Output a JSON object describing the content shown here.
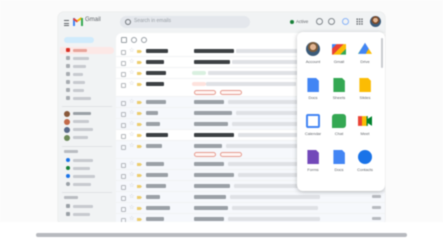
{
  "header": {
    "app_name": "Gmail",
    "search_placeholder": "Search in emails",
    "status": "Active",
    "icons": [
      "menu-icon",
      "gmail-logo",
      "search-icon",
      "status-dot",
      "help-icon",
      "settings-icon",
      "gemini-icon",
      "apps-grid-icon",
      "avatar"
    ]
  },
  "apps_panel": {
    "items": [
      {
        "label": "Account",
        "icon": "account-icon",
        "color": "#7a5a3a"
      },
      {
        "label": "Gmail",
        "icon": "gmail-icon",
        "color": "#ea4335"
      },
      {
        "label": "Drive",
        "icon": "drive-icon",
        "color": "#fbbc04"
      },
      {
        "label": "Docs",
        "icon": "docs-icon",
        "color": "#4285f4"
      },
      {
        "label": "Sheets",
        "icon": "sheets-icon",
        "color": "#34a853"
      },
      {
        "label": "Slides",
        "icon": "slides-icon",
        "color": "#fbbc04"
      },
      {
        "label": "Calendar",
        "icon": "calendar-icon",
        "color": "#4285f4"
      },
      {
        "label": "Chat",
        "icon": "chat-icon",
        "color": "#34a853"
      },
      {
        "label": "Meet",
        "icon": "meet-icon",
        "color": "#00832d"
      },
      {
        "label": "Forms",
        "icon": "forms-icon",
        "color": "#7248b9"
      },
      {
        "label": "Docs",
        "icon": "docs-icon",
        "color": "#4285f4"
      },
      {
        "label": "Contacts",
        "icon": "contacts-icon",
        "color": "#1a73e8"
      }
    ]
  },
  "colors": {
    "accent_red": "#ea4335",
    "accent_blue": "#4285f4",
    "accent_green": "#34a853",
    "accent_yellow": "#fbbc04",
    "active_nav_bg": "#fce8e6"
  }
}
